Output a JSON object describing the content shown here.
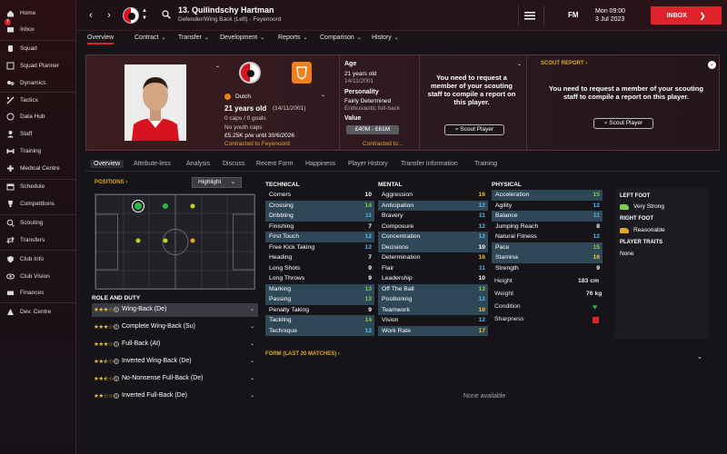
{
  "sidebar": {
    "items": [
      {
        "label": "Home",
        "icon": "home-icon"
      },
      {
        "label": "Inbox",
        "icon": "inbox-icon",
        "badge": "7"
      },
      {
        "label": "Squad",
        "icon": "squad-icon"
      },
      {
        "label": "Squad Planner",
        "icon": "squad-planner-icon"
      },
      {
        "label": "Dynamics",
        "icon": "dynamics-icon"
      },
      {
        "label": "Tactics",
        "icon": "tactics-icon"
      },
      {
        "label": "Data Hub",
        "icon": "data-hub-icon"
      },
      {
        "label": "Staff",
        "icon": "staff-icon"
      },
      {
        "label": "Training",
        "icon": "training-icon"
      },
      {
        "label": "Medical Centre",
        "icon": "medical-icon"
      },
      {
        "label": "Schedule",
        "icon": "schedule-icon"
      },
      {
        "label": "Competitions",
        "icon": "trophy-icon"
      },
      {
        "label": "Scouting",
        "icon": "scouting-icon"
      },
      {
        "label": "Transfers",
        "icon": "transfers-icon"
      },
      {
        "label": "Club Info",
        "icon": "club-info-icon"
      },
      {
        "label": "Club Vision",
        "icon": "club-vision-icon"
      },
      {
        "label": "Finances",
        "icon": "finances-icon"
      },
      {
        "label": "Dev. Centre",
        "icon": "dev-centre-icon"
      }
    ]
  },
  "topbar": {
    "player_title": "13. Quilindschy Hartman",
    "player_subtitle": "Defender/Wing Back (Left) - Feyenoord",
    "fm_logo": "FM",
    "date_line1": "Mon 09:00",
    "date_line2": "3 Jul 2023",
    "inbox_label": "INBOX",
    "inbox_arrow": "❯"
  },
  "subnav": {
    "items": [
      "Overview",
      "Contract",
      "Transfer",
      "Development",
      "Reports",
      "Comparison",
      "History"
    ],
    "active": "Overview"
  },
  "header": {
    "nationality": "Dutch",
    "age_line": "21 years old",
    "dob": "(14/11/2001)",
    "caps": "0 caps / 0 goals",
    "youth_caps": "No youth caps",
    "wage": "£5.25K p/w until 30/6/2026",
    "contracted": "Contracted to Feyenoord",
    "age_label": "Age",
    "age_value": "21 years old",
    "age_dob": "14/11/2001",
    "personality_label": "Personality",
    "personality_value": "Fairly Determined",
    "media_handling": "Enthusiastic full-back",
    "value_label": "Value",
    "value_value": "£40M - £61M",
    "contracted_to": "Contracted to...",
    "scout_message": "You need to request a member of your scouting staff to compile a report on this player.",
    "scout_button": "Scout Player",
    "scout_report_title": "SCOUT REPORT",
    "scout_report_arrow": "›",
    "scout_report_message": "You need to request a member of your scouting staff to compile a report on this player.",
    "scout_report_button": "Scout Player"
  },
  "tabs": {
    "items": [
      "Overview",
      "Attribute-less",
      "Analysis",
      "Discuss",
      "Recent Form",
      "Happiness",
      "Player History",
      "Transfer Information",
      "Training"
    ],
    "active": "Overview"
  },
  "positions": {
    "title": "POSITIONS",
    "title_arrow": "›",
    "highlight_label": "Highlight",
    "role_duty_title": "ROLE AND DUTY",
    "roles": [
      {
        "name": "Wing-Back (De)",
        "stars": "★★★☆☆",
        "selected": true
      },
      {
        "name": "Complete Wing-Back (Su)",
        "stars": "★★★☆☆",
        "selected": false
      },
      {
        "name": "Full-Back (At)",
        "stars": "★★★☆☆",
        "selected": false
      },
      {
        "name": "Inverted Wing-Back (De)",
        "stars": "★★⯪☆☆",
        "selected": false
      },
      {
        "name": "No-Nonsense Full-Back (De)",
        "stars": "★★⯪☆☆",
        "selected": false
      },
      {
        "name": "Inverted Full-Back (De)",
        "stars": "★★☆☆☆",
        "selected": false
      }
    ],
    "colors": {
      "natural": "#2fb34a",
      "accomplished": "#c7cf2a",
      "competent": "#e0a72a"
    }
  },
  "technical": {
    "title": "TECHNICAL",
    "attrs": [
      {
        "name": "Corners",
        "value": "10",
        "hl": false
      },
      {
        "name": "Crossing",
        "value": "14",
        "hl": true
      },
      {
        "name": "Dribbling",
        "value": "11",
        "hl": true
      },
      {
        "name": "Finishing",
        "value": "7",
        "hl": false
      },
      {
        "name": "First Touch",
        "value": "12",
        "hl": true
      },
      {
        "name": "Free Kick Taking",
        "value": "12",
        "hl": false
      },
      {
        "name": "Heading",
        "value": "7",
        "hl": false
      },
      {
        "name": "Long Shots",
        "value": "9",
        "hl": false
      },
      {
        "name": "Long Throws",
        "value": "9",
        "hl": false
      },
      {
        "name": "Marking",
        "value": "13",
        "hl": true
      },
      {
        "name": "Passing",
        "value": "13",
        "hl": true
      },
      {
        "name": "Penalty Taking",
        "value": "9",
        "hl": false
      },
      {
        "name": "Tackling",
        "value": "14",
        "hl": true
      },
      {
        "name": "Technique",
        "value": "12",
        "hl": true
      }
    ]
  },
  "mental": {
    "title": "MENTAL",
    "attrs": [
      {
        "name": "Aggression",
        "value": "16",
        "hl": false
      },
      {
        "name": "Anticipation",
        "value": "12",
        "hl": true
      },
      {
        "name": "Bravery",
        "value": "11",
        "hl": false
      },
      {
        "name": "Composure",
        "value": "12",
        "hl": false
      },
      {
        "name": "Concentration",
        "value": "12",
        "hl": true
      },
      {
        "name": "Decisions",
        "value": "10",
        "hl": true
      },
      {
        "name": "Determination",
        "value": "16",
        "hl": false
      },
      {
        "name": "Flair",
        "value": "11",
        "hl": false
      },
      {
        "name": "Leadership",
        "value": "10",
        "hl": false
      },
      {
        "name": "Off The Ball",
        "value": "13",
        "hl": true
      },
      {
        "name": "Positioning",
        "value": "12",
        "hl": true
      },
      {
        "name": "Teamwork",
        "value": "16",
        "hl": true
      },
      {
        "name": "Vision",
        "value": "12",
        "hl": false
      },
      {
        "name": "Work Rate",
        "value": "17",
        "hl": true
      }
    ]
  },
  "physical": {
    "title": "PHYSICAL",
    "attrs": [
      {
        "name": "Acceleration",
        "value": "15",
        "hl": true
      },
      {
        "name": "Agility",
        "value": "12",
        "hl": false
      },
      {
        "name": "Balance",
        "value": "11",
        "hl": true
      },
      {
        "name": "Jumping Reach",
        "value": "8",
        "hl": false
      },
      {
        "name": "Natural Fitness",
        "value": "12",
        "hl": false
      },
      {
        "name": "Pace",
        "value": "15",
        "hl": true
      },
      {
        "name": "Stamina",
        "value": "16",
        "hl": true
      },
      {
        "name": "Strength",
        "value": "9",
        "hl": false
      }
    ],
    "height_label": "Height",
    "height_value": "183 cm",
    "weight_label": "Weight",
    "weight_value": "76 kg",
    "condition_label": "Condition",
    "sharpness_label": "Sharpness"
  },
  "feet": {
    "left_title": "LEFT FOOT",
    "left_value": "Very Strong",
    "right_title": "RIGHT FOOT",
    "right_value": "Reasonable",
    "traits_title": "PLAYER TRAITS",
    "traits_value": "None"
  },
  "form": {
    "title": "FORM (LAST 20 MATCHES)",
    "title_arrow": "›",
    "none": "None available"
  }
}
